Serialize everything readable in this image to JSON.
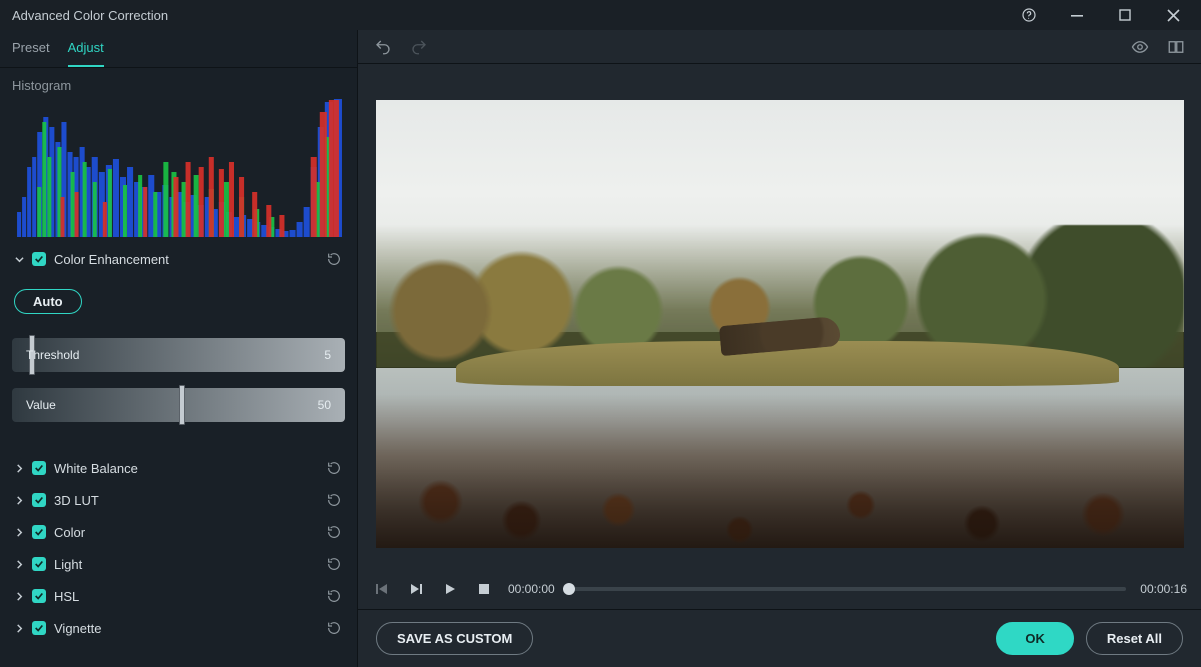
{
  "window_title": "Advanced Color Correction",
  "tabs": {
    "preset": "Preset",
    "adjust": "Adjust",
    "active": "adjust"
  },
  "sidebar": {
    "histogram_label": "Histogram",
    "color_enhancement": {
      "label": "Color Enhancement",
      "expanded": true,
      "checked": true,
      "auto_label": "Auto",
      "threshold": {
        "label": "Threshold",
        "value": "5",
        "percent": 5
      },
      "value": {
        "label": "Value",
        "value": "50",
        "percent": 50
      }
    },
    "sections": [
      {
        "key": "white_balance",
        "label": "White Balance",
        "checked": true
      },
      {
        "key": "lut3d",
        "label": "3D LUT",
        "checked": true
      },
      {
        "key": "color",
        "label": "Color",
        "checked": true
      },
      {
        "key": "light",
        "label": "Light",
        "checked": true
      },
      {
        "key": "hsl",
        "label": "HSL",
        "checked": true
      },
      {
        "key": "vignette",
        "label": "Vignette",
        "checked": true
      }
    ]
  },
  "playback": {
    "current": "00:00:00",
    "duration": "00:00:16",
    "position_percent": 0
  },
  "footer": {
    "save_custom": "SAVE AS CUSTOM",
    "ok": "OK",
    "reset_all": "Reset All"
  }
}
